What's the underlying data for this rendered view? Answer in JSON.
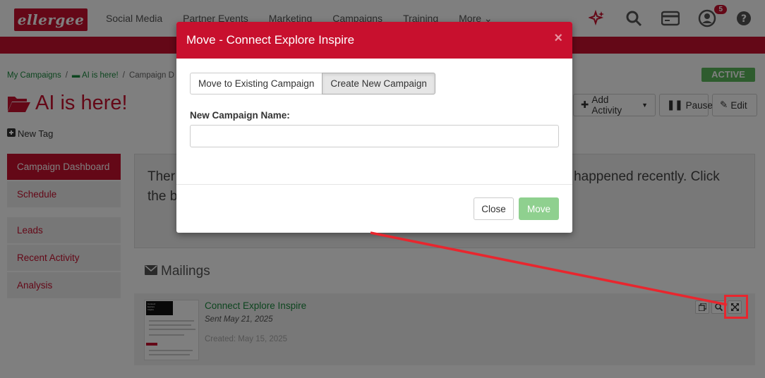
{
  "header": {
    "logo_text": "ellergee",
    "nav": [
      "Social Media",
      "Partner Events",
      "Marketing",
      "Campaigns",
      "Training",
      "More"
    ],
    "icons": [
      "sparkle-icon",
      "search-icon",
      "card-icon",
      "user-icon",
      "help-icon"
    ],
    "notifications_count": "5"
  },
  "breadcrumb": {
    "items": [
      "My Campaigns",
      "AI is here!",
      "Campaign D"
    ],
    "separator": "/"
  },
  "status_badge": "ACTIVE",
  "page": {
    "title": "AI is here!",
    "new_tag": "New Tag"
  },
  "actions": {
    "add_activity": "Add Activity",
    "pause": "Pause",
    "edit": "Edit"
  },
  "sidebar": {
    "items": [
      {
        "label": "Campaign Dashboard",
        "active": true
      },
      {
        "label": "Schedule",
        "active": false
      },
      {
        "label": "Leads",
        "active": false
      },
      {
        "label": "Recent Activity",
        "active": false
      },
      {
        "label": "Analysis",
        "active": false
      }
    ]
  },
  "info": {
    "line1_left": "Ther",
    "line1_right": "happened recently. Click",
    "line2_left": "the b"
  },
  "mailings": {
    "heading": "Mailings",
    "item": {
      "title": "Connect Explore Inspire",
      "sent": "Sent May 21, 2025",
      "created": "Created: May 15, 2025",
      "thumb_text": [
        "Connect",
        "Explore",
        "Inspire"
      ]
    }
  },
  "modal": {
    "title": "Move - Connect Explore Inspire",
    "close_symbol": "×",
    "tabs": [
      "Move to Existing Campaign",
      "Create New Campaign"
    ],
    "selected_tab": "Create New Campaign",
    "field_label": "New Campaign Name:",
    "field_value": "",
    "field_placeholder": "",
    "close_btn": "Close",
    "move_btn": "Move"
  },
  "colors": {
    "brand": "#c8102e",
    "link": "#1a8a3e",
    "active": "#5cb85c",
    "annotation": "#e8262e"
  }
}
